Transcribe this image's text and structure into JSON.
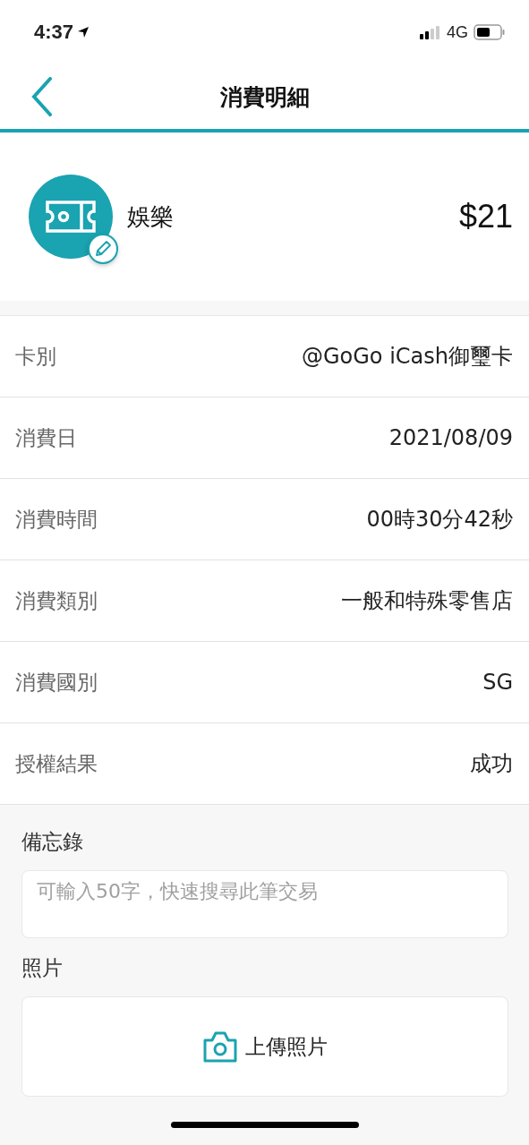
{
  "status_bar": {
    "time": "4:37",
    "network": "4G"
  },
  "nav": {
    "title": "消費明細"
  },
  "summary": {
    "category": "娛樂",
    "amount": "$21"
  },
  "details": [
    {
      "label": "卡別",
      "value": "@GoGo iCash御璽卡"
    },
    {
      "label": "消費日",
      "value": "2021/08/09"
    },
    {
      "label": "消費時間",
      "value": "00時30分42秒"
    },
    {
      "label": "消費類別",
      "value": "一般和特殊零售店"
    },
    {
      "label": "消費國別",
      "value": "SG"
    },
    {
      "label": "授權結果",
      "value": "成功"
    }
  ],
  "memo": {
    "label": "備忘錄",
    "placeholder": "可輸入50字，快速搜尋此筆交易"
  },
  "photo": {
    "label": "照片",
    "button": "上傳照片"
  }
}
